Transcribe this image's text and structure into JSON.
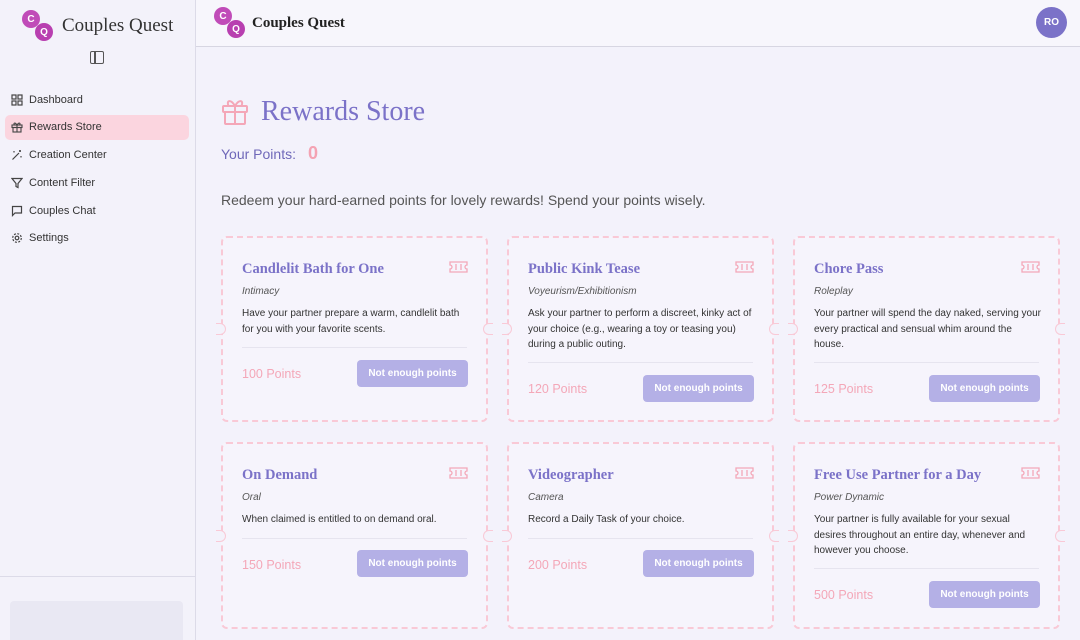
{
  "app": {
    "name": "Couples Quest",
    "logo_letters": [
      "C",
      "Q"
    ]
  },
  "sidebar": {
    "items": [
      {
        "label": "Dashboard",
        "icon": "dashboard-icon"
      },
      {
        "label": "Rewards Store",
        "icon": "gift-icon",
        "active": true
      },
      {
        "label": "Creation Center",
        "icon": "wand-icon"
      },
      {
        "label": "Content Filter",
        "icon": "filter-icon"
      },
      {
        "label": "Couples Chat",
        "icon": "chat-icon"
      },
      {
        "label": "Settings",
        "icon": "gear-icon"
      }
    ]
  },
  "header": {
    "title": "Couples Quest",
    "avatar_initials": "RO"
  },
  "main": {
    "title": "Rewards Store",
    "points_label": "Your Points:",
    "points_value": "0",
    "intro": "Redeem your hard-earned points for lovely rewards! Spend your points wisely."
  },
  "rewards": [
    {
      "title": "Candlelit Bath for One",
      "category": "Intimacy",
      "description": "Have your partner prepare a warm, candlelit bath for you with your favorite scents.",
      "points": "100 Points",
      "button": "Not enough points"
    },
    {
      "title": "Public Kink Tease",
      "category": "Voyeurism/Exhibitionism",
      "description": "Ask your partner to perform a discreet, kinky act of your choice (e.g., wearing a toy or teasing you) during a public outing.",
      "points": "120 Points",
      "button": "Not enough points"
    },
    {
      "title": "Chore Pass",
      "category": "Roleplay",
      "description": "Your partner will spend the day naked, serving your every practical and sensual whim around the house.",
      "points": "125 Points",
      "button": "Not enough points"
    },
    {
      "title": "On Demand",
      "category": "Oral",
      "description": "When claimed is entitled to on demand oral.",
      "points": "150 Points",
      "button": "Not enough points"
    },
    {
      "title": "Videographer",
      "category": "Camera",
      "description": "Record a Daily Task of your choice.",
      "points": "200 Points",
      "button": "Not enough points"
    },
    {
      "title": "Free Use Partner for a Day",
      "category": "Power Dynamic",
      "description": "Your partner is fully available for your sexual desires throughout an entire day, whenever and however you choose.",
      "points": "500 Points",
      "button": "Not enough points"
    }
  ],
  "colors": {
    "accent": "#7b72c8",
    "pink": "#f4a3b3",
    "active_nav": "#fbd5df",
    "button": "#b4b0e6",
    "logo": "#c04bb8"
  }
}
